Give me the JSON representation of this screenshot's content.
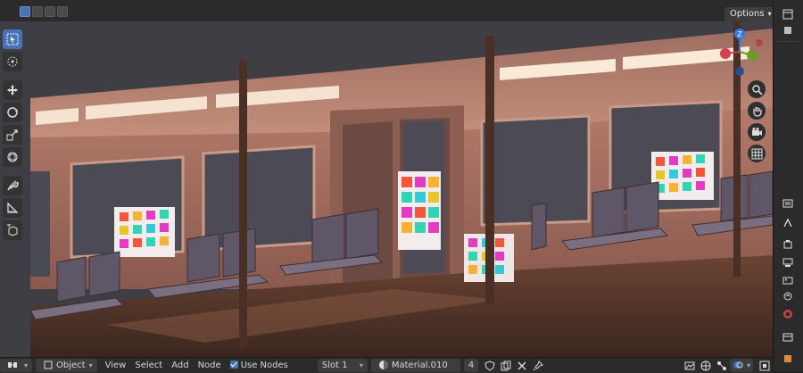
{
  "header": {
    "options_label": "Options",
    "select_modes": [
      "select-box-icon",
      "select-extend-icon",
      "select-subtract-icon",
      "select-invert-icon"
    ]
  },
  "toolbar": {
    "tools": [
      "cursor-select-icon",
      "3d-cursor-icon",
      "move-icon",
      "rotate-icon",
      "scale-icon",
      "transform-icon",
      "annotate-icon",
      "measure-icon",
      "add-cube-icon"
    ],
    "active_index": 0
  },
  "gizmo": {
    "z_label": "Z",
    "colors": {
      "x": "#d4414d",
      "y": "#6a9b23",
      "z": "#2f7be0"
    }
  },
  "nav": {
    "buttons": [
      "zoom-icon",
      "pan-hand-icon",
      "camera-icon",
      "grid-view-icon"
    ]
  },
  "footer": {
    "mode": "Object",
    "menus": [
      "View",
      "Select",
      "Add",
      "Node"
    ],
    "use_nodes_label": "Use Nodes",
    "use_nodes_checked": true,
    "slot": "Slot 1",
    "material": "Material.010",
    "user_count": "4"
  },
  "colors": {
    "accent": "#4772b3",
    "panel": "#2b2b2b",
    "viewport_bg": "#3e3e44"
  }
}
